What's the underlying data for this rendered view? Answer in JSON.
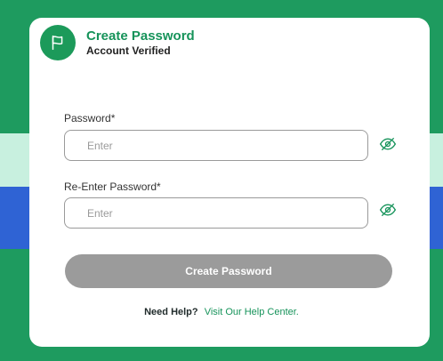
{
  "header": {
    "title": "Create Password",
    "subtitle": "Account Verified",
    "logo_icon": "flag-icon"
  },
  "password": {
    "label": "Password*",
    "placeholder": "Enter",
    "toggle_icon": "eye-slash-icon"
  },
  "confirm_password": {
    "label": "Re-Enter Password*",
    "placeholder": "Enter",
    "toggle_icon": "eye-slash-icon"
  },
  "submit": {
    "label": "Create Password",
    "state": "disabled"
  },
  "help": {
    "prefix": "Need Help?",
    "link": "Visit Our Help Center."
  },
  "colors": {
    "brand_green": "#16935a",
    "background_green": "#1e9b5f",
    "mint_band": "#c8f0df",
    "blue_band": "#2f63d4",
    "disabled_button": "#9b9b9b"
  }
}
